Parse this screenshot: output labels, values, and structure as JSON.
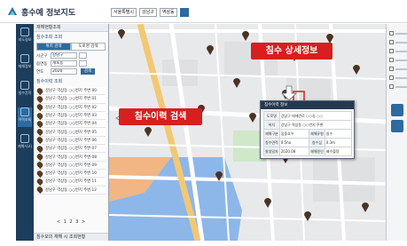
{
  "app": {
    "title": "홍수예 정보지도"
  },
  "left_rail": [
    {
      "label": "지도정보",
      "active": false
    },
    {
      "label": "재해정보",
      "active": false
    },
    {
      "label": "침수흔적",
      "active": false
    },
    {
      "label": "이력조회",
      "active": true
    },
    {
      "label": "재해사고관리현황",
      "active": false
    }
  ],
  "panel": {
    "header": "재해현황조회",
    "section": "침수조회 조회",
    "tabs": [
      "위치 검색",
      "도로명 검색"
    ],
    "fields": [
      {
        "label": "시군구",
        "value": "강남구"
      },
      {
        "label": "읍면동",
        "value": "개포동"
      },
      {
        "label": "연도",
        "value": "2020"
      }
    ],
    "search_button": "검색",
    "results_title": "침수이력 조회",
    "results": [
      "강남구 역삼동 ○○번지 주변 00",
      "강남구 역삼동 ○○번지 주변 01",
      "강남구 역삼동 ○○번지 주변 02",
      "강남구 역삼동 ○○번지 주변 03",
      "강남구 역삼동 ○○번지 주변 04",
      "강남구 역삼동 ○○번지 주변 05",
      "강남구 역삼동 ○○번지 주변 06",
      "강남구 역삼동 ○○번지 주변 07",
      "강남구 역삼동 ○○번지 주변 08",
      "강남구 역삼동 ○○번지 주변 09",
      "강남구 역삼동 ○○번지 주변 10",
      "강남구 역삼동 ○○번지 주변 11",
      "강남구 역삼동 ○○번지 주변 12"
    ],
    "pagination": "< 1 2 3 >",
    "footer": "침수모의 재해 시 조회현황"
  },
  "map_toolbar": {
    "sido": "서울특별시",
    "sigungu": "강남구",
    "dong": "역삼동"
  },
  "popup": {
    "title": "침수이력 정보",
    "rows": [
      {
        "k": "도로명",
        "v": "강남구 테헤란로 ○○길 ○○"
      },
      {
        "k": "위치",
        "v": "강남구 역삼동 ○○번지 주변"
      },
      {
        "k": "재해구분",
        "v": "집중호우",
        "k2": "재해유형",
        "v2": "침수"
      },
      {
        "k": "침수면적",
        "v": "0.5ha",
        "k2": "침수심",
        "v2": "0.3m"
      },
      {
        "k": "발생일자",
        "v": "2020.08",
        "k2": "재해원인",
        "v2": "배수불량"
      }
    ]
  },
  "callouts": {
    "detail": "침수 상세정보",
    "history": "침수이력 검색"
  },
  "colors": {
    "callout": "#d71f1f",
    "rail": "#1c3d5c",
    "accent": "#2d6aa0",
    "flood_orange": "#f4a86a",
    "flood_blue": "#6fa6e8"
  }
}
